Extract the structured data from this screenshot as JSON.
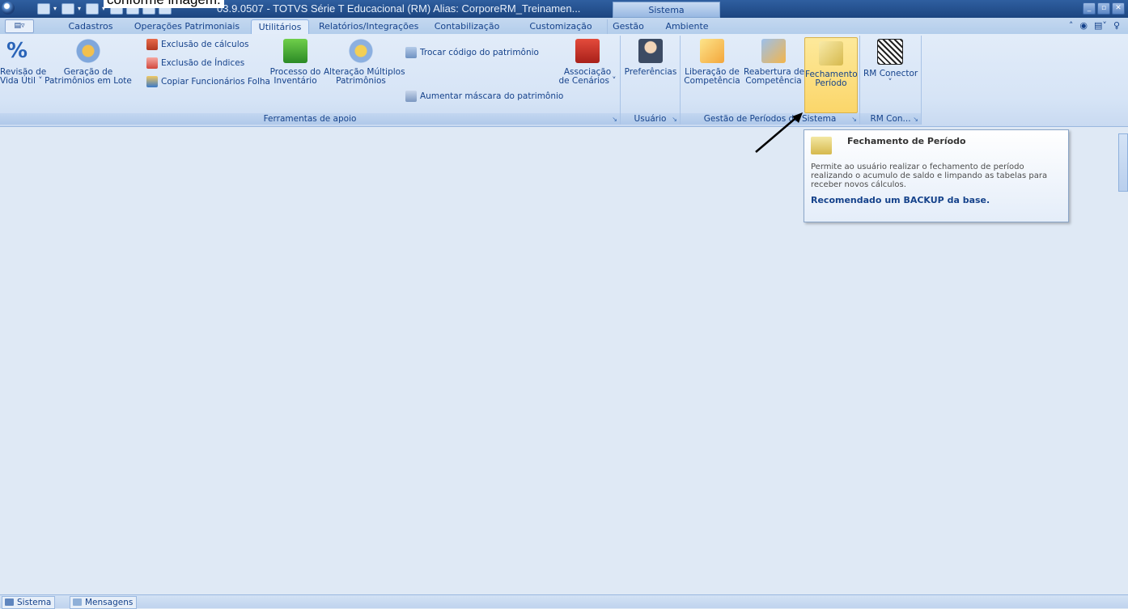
{
  "doc_snippet": "conforme imagem.",
  "titlebar": {
    "title": "03.9.0507 - TOTVS Série T Educacional (RM) Alias: CorporeRM_Treinamen...",
    "context_tab": "Sistema"
  },
  "tabs": [
    "Cadastros",
    "Operações Patrimoniais",
    "Utilitários",
    "Relatórios/Integrações",
    "Contabilização",
    "Customização",
    "Gestão",
    "Ambiente"
  ],
  "active_tab": "Utilitários",
  "ribbon": {
    "ferramentas": {
      "label": "Ferramentas de apoio",
      "revisao": "Revisão de\nVida Útil ˅",
      "geracao": "Geração de\nPatrimônios em Lote",
      "exclusao_calculos": "Exclusão de cálculos",
      "exclusao_indices": "Exclusão de Índices",
      "copiar_func": "Copiar Funcionários Folha",
      "processo_inv": "Processo do\nInventário",
      "alteracao_mult": "Alteração Múltiplos\nPatrimônios",
      "trocar_codigo": "Trocar código do patrimônio",
      "aumentar_mascara": "Aumentar máscara do patrimônio",
      "associacao": "Associação\nde Cenários ˅"
    },
    "usuario": {
      "label": "Usuário",
      "preferencias": "Preferências"
    },
    "gestao": {
      "label": "Gestão de Períodos do Sistema",
      "liberacao": "Liberação de\nCompetência",
      "reabertura": "Reabertura de\nCompetência",
      "fechamento": "Fechamento\nPeríodo"
    },
    "rmcon": {
      "label": "RM Con...",
      "rm_conector": "RM Conector\n˅"
    }
  },
  "tooltip": {
    "title": "Fechamento de Período",
    "description": "Permite ao usuário realizar o fechamento de período realizando o acumulo de saldo e limpando as tabelas para receber novos cálculos.",
    "note": "Recomendado um BACKUP da base."
  },
  "statusbar": {
    "sistema": "Sistema",
    "mensagens": "Mensagens"
  },
  "colors": {
    "accent": "#15428b",
    "titlebar": "#1c4580",
    "workspace": "#dfe9f5",
    "highlight": "#fbd66a"
  }
}
